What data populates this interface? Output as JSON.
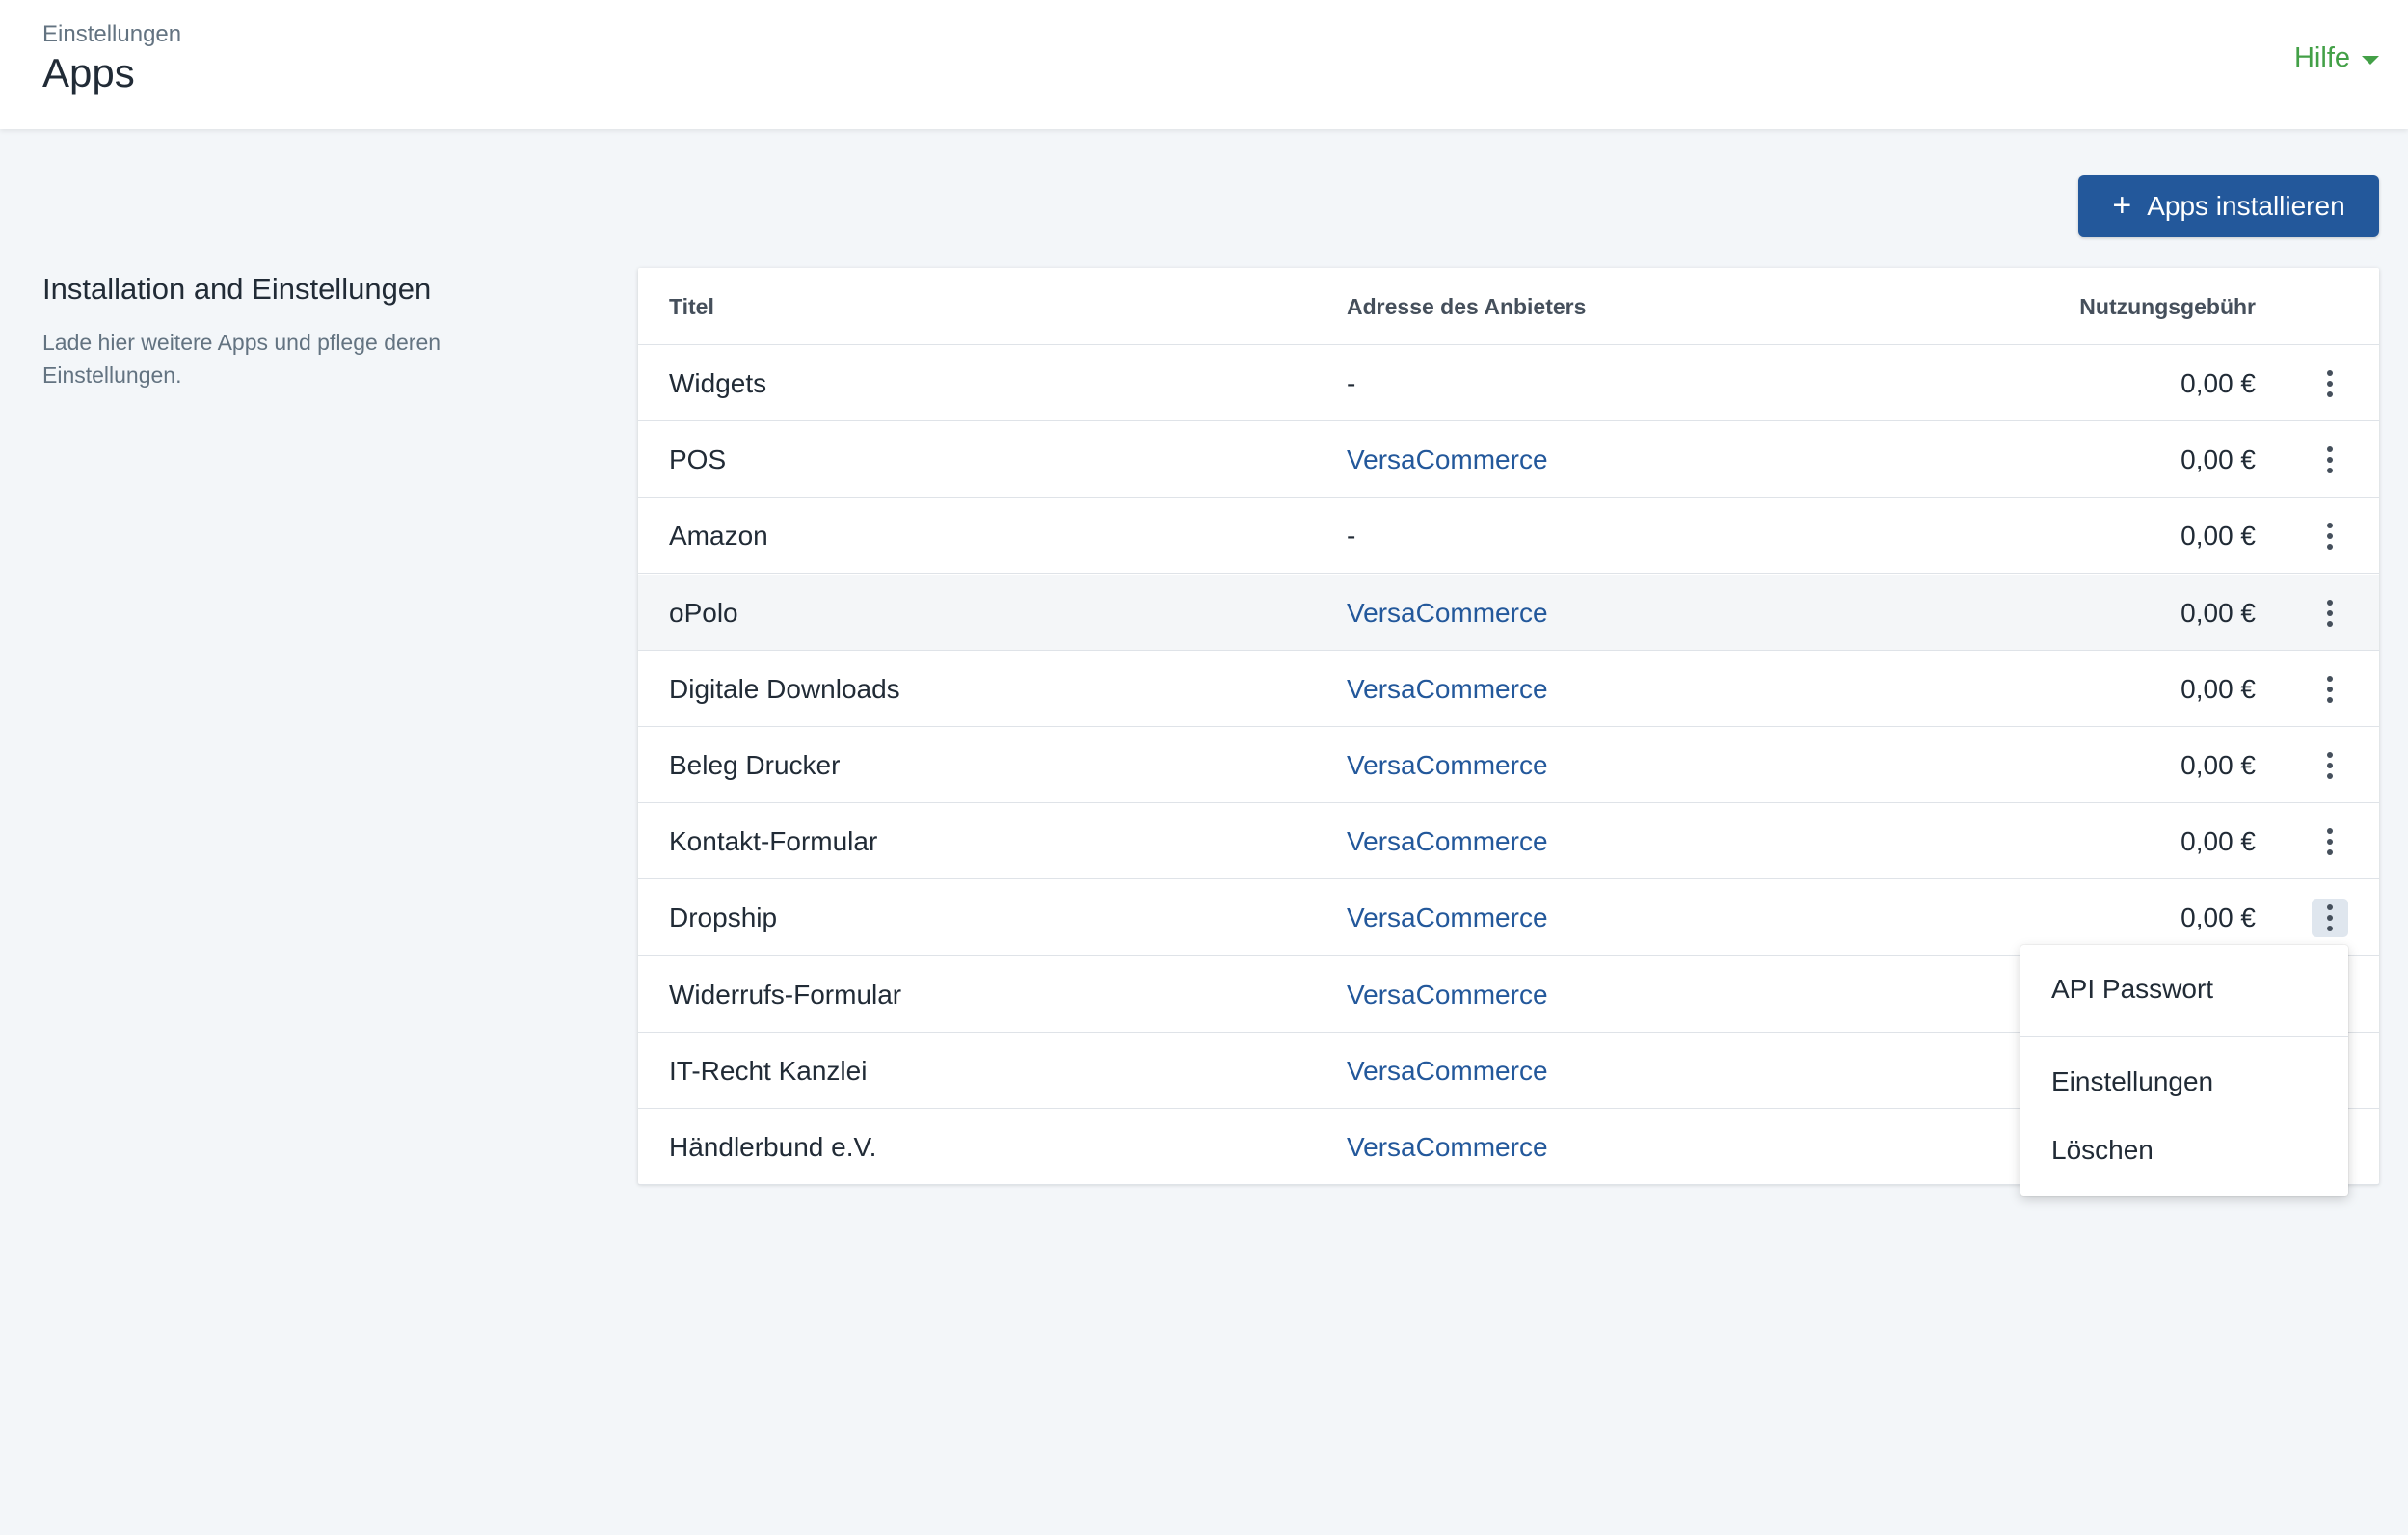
{
  "header": {
    "breadcrumb": "Einstellungen",
    "title": "Apps",
    "help_label": "Hilfe",
    "accent_color": "#43a047"
  },
  "toolbar": {
    "install_label": "Apps installieren",
    "install_icon": "plus-icon",
    "button_color": "#23589b"
  },
  "section": {
    "title": "Installation and Einstellungen",
    "description": "Lade hier weitere Apps und pflege deren Einstellungen."
  },
  "table": {
    "columns": {
      "title": "Titel",
      "vendor": "Adresse des Anbieters",
      "fee": "Nutzungsgebühr"
    },
    "rows": [
      {
        "title": "Widgets",
        "vendor": "-",
        "fee": "0,00 €"
      },
      {
        "title": "POS",
        "vendor": "VersaCommerce",
        "fee": "0,00 €"
      },
      {
        "title": "Amazon",
        "vendor": "-",
        "fee": "0,00 €"
      },
      {
        "title": "oPolo",
        "vendor": "VersaCommerce",
        "fee": "0,00 €"
      },
      {
        "title": "Digitale Downloads",
        "vendor": "VersaCommerce",
        "fee": "0,00 €"
      },
      {
        "title": "Beleg Drucker",
        "vendor": "VersaCommerce",
        "fee": "0,00 €"
      },
      {
        "title": "Kontakt-Formular",
        "vendor": "VersaCommerce",
        "fee": "0,00 €"
      },
      {
        "title": "Dropship",
        "vendor": "VersaCommerce",
        "fee": "0,00 €"
      },
      {
        "title": "Widerrufs-Formular",
        "vendor": "VersaCommerce",
        "fee": ""
      },
      {
        "title": "IT-Recht Kanzlei",
        "vendor": "VersaCommerce",
        "fee": ""
      },
      {
        "title": "Händlerbund e.V.",
        "vendor": "VersaCommerce",
        "fee": ""
      }
    ]
  },
  "dropdown": {
    "items": [
      {
        "label": "API Passwort"
      },
      {
        "label": "Einstellungen"
      },
      {
        "label": "Löschen"
      }
    ]
  }
}
